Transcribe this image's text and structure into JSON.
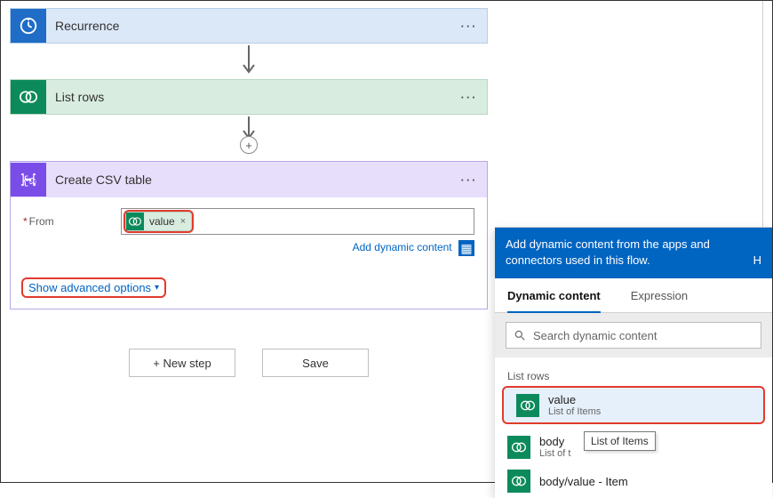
{
  "steps": {
    "recurrence": {
      "title": "Recurrence"
    },
    "listrows": {
      "title": "List rows"
    },
    "csv": {
      "title": "Create CSV table",
      "from_label": "From",
      "token_label": "value",
      "add_dyn_label": "Add dynamic content",
      "adv_label": "Show advanced options"
    }
  },
  "actions": {
    "new_step": "+ New step",
    "save": "Save"
  },
  "dyn": {
    "banner": "Add dynamic content from the apps and connectors used in this flow.",
    "banner_hide": "H",
    "tabs": {
      "dynamic": "Dynamic content",
      "expression": "Expression"
    },
    "search_placeholder": "Search dynamic content",
    "section": "List rows",
    "items": [
      {
        "title": "value",
        "sub": "List of Items"
      },
      {
        "title": "body",
        "sub": "List of t"
      },
      {
        "title": "body/value - Item",
        "sub": ""
      }
    ],
    "tooltip": "List of Items"
  }
}
